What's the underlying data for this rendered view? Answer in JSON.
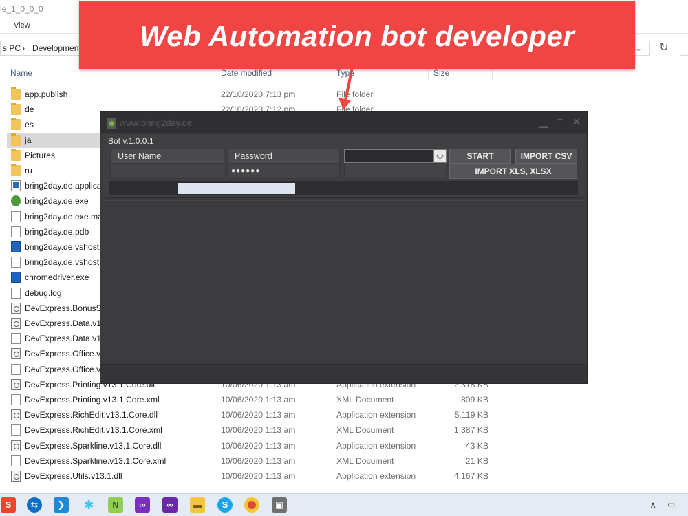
{
  "explorer": {
    "title_fragment": "le_1_0_0_0",
    "menu_view": "View",
    "breadcrumb_pc": "s PC",
    "breadcrumb_sep": "›",
    "breadcrumb_folder": "Developmen",
    "nav_dropdown": "⌄",
    "refresh": "↻",
    "columns": {
      "name": "Name",
      "date": "Date modified",
      "type": "Type",
      "size": "Size"
    },
    "files": [
      {
        "name": "app.publish",
        "date": "22/10/2020 7:13 pm",
        "type": "File folder",
        "size": "",
        "icon": "folder-icon"
      },
      {
        "name": "de",
        "date": "22/10/2020 7:12 pm",
        "type": "File folder",
        "size": "",
        "icon": "folder-icon"
      },
      {
        "name": "es",
        "date": "",
        "type": "",
        "size": "",
        "icon": "folder-icon"
      },
      {
        "name": "ja",
        "date": "",
        "type": "",
        "size": "",
        "icon": "folder-icon"
      },
      {
        "name": "Pictures",
        "date": "",
        "type": "",
        "size": "",
        "icon": "folder-icon"
      },
      {
        "name": "ru",
        "date": "",
        "type": "",
        "size": "",
        "icon": "folder-icon"
      },
      {
        "name": "bring2day.de.applica",
        "date": "",
        "type": "",
        "size": "",
        "icon": "application-manifest-icon"
      },
      {
        "name": "bring2day.de.exe",
        "date": "",
        "type": "",
        "size": "",
        "icon": "exe-icon"
      },
      {
        "name": "bring2day.de.exe.ma",
        "date": "",
        "type": "",
        "size": "",
        "icon": "file-icon"
      },
      {
        "name": "bring2day.de.pdb",
        "date": "",
        "type": "",
        "size": "",
        "icon": "file-icon"
      },
      {
        "name": "bring2day.de.vshost",
        "date": "",
        "type": "",
        "size": "",
        "icon": "vshost-icon"
      },
      {
        "name": "bring2day.de.vshost",
        "date": "",
        "type": "",
        "size": "",
        "icon": "file-icon"
      },
      {
        "name": "chromedriver.exe",
        "date": "",
        "type": "",
        "size": "",
        "icon": "vshost-icon"
      },
      {
        "name": "debug.log",
        "date": "",
        "type": "",
        "size": "",
        "icon": "file-icon"
      },
      {
        "name": "DevExpress.BonusSk",
        "date": "",
        "type": "",
        "size": "",
        "icon": "dll-icon"
      },
      {
        "name": "DevExpress.Data.v13",
        "date": "",
        "type": "",
        "size": "",
        "icon": "dll-icon"
      },
      {
        "name": "DevExpress.Data.v13",
        "date": "",
        "type": "",
        "size": "",
        "icon": "file-icon"
      },
      {
        "name": "DevExpress.Office.v1",
        "date": "",
        "type": "",
        "size": "",
        "icon": "dll-icon"
      },
      {
        "name": "DevExpress.Office.v1",
        "date": "",
        "type": "",
        "size": "",
        "icon": "file-icon"
      },
      {
        "name": "DevExpress.Printing.v13.1.Core.dll",
        "date": "10/06/2020 1:13 am",
        "type": "Application extension",
        "size": "2,318 KB",
        "icon": "dll-icon"
      },
      {
        "name": "DevExpress.Printing.v13.1.Core.xml",
        "date": "10/06/2020 1:13 am",
        "type": "XML Document",
        "size": "809 KB",
        "icon": "file-icon"
      },
      {
        "name": "DevExpress.RichEdit.v13.1.Core.dll",
        "date": "10/06/2020 1:13 am",
        "type": "Application extension",
        "size": "5,119 KB",
        "icon": "dll-icon"
      },
      {
        "name": "DevExpress.RichEdit.v13.1.Core.xml",
        "date": "10/06/2020 1:13 am",
        "type": "XML Document",
        "size": "1,387 KB",
        "icon": "file-icon"
      },
      {
        "name": "DevExpress.Sparkline.v13.1.Core.dll",
        "date": "10/06/2020 1:13 am",
        "type": "Application extension",
        "size": "43 KB",
        "icon": "dll-icon"
      },
      {
        "name": "DevExpress.Sparkline.v13.1.Core.xml",
        "date": "10/06/2020 1:13 am",
        "type": "XML Document",
        "size": "21 KB",
        "icon": "file-icon"
      },
      {
        "name": "DevExpress.Utils.v13.1.dll",
        "date": "10/06/2020 1:13 am",
        "type": "Application extension",
        "size": "4,167 KB",
        "icon": "dll-icon"
      }
    ]
  },
  "banner": {
    "text": "Web Automation bot developer"
  },
  "bot": {
    "title": "www.bring2day.de",
    "version": "Bot v.1.0.0.1",
    "username_label": "User Name",
    "password_label": "Password",
    "username_value": "",
    "password_value": "●●●●●●",
    "combo_value": "",
    "start_label": "START",
    "import_csv_label": "IMPORT CSV",
    "import_xls_label": "IMPORT XLS, XLSX",
    "progress_fraction": 0.25,
    "minimize": "▁",
    "maximize": "□",
    "close": "✕"
  },
  "taskbar": {
    "icons": [
      "sublime-icon",
      "teamviewer-icon",
      "vscode-icon",
      "slack-icon",
      "notepadpp-icon",
      "visual-studio-icon",
      "visual-studio-2-icon",
      "file-explorer-icon",
      "skype-icon",
      "chrome-icon",
      "bring2day-icon"
    ],
    "tray_chevron": "∧"
  }
}
